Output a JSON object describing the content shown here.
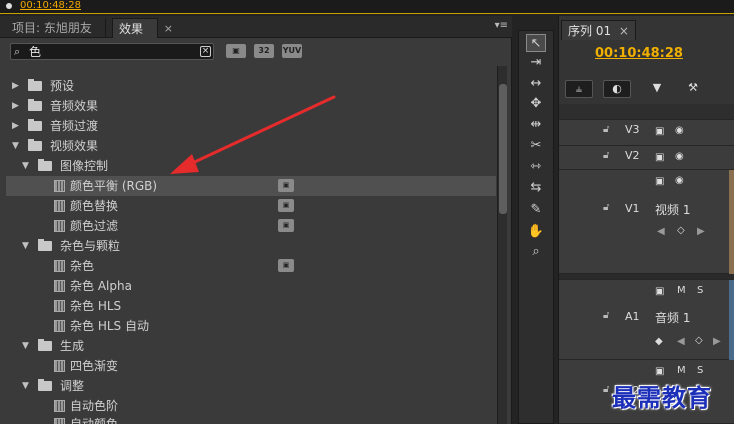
{
  "top_timecode": "00:10:48:28",
  "tabs": {
    "project": "项目: 东旭朋友",
    "effects": "效果",
    "close": "×",
    "menu": "▾≡"
  },
  "search": {
    "value": "色",
    "clear": "×"
  },
  "filter_buttons": [
    "32",
    "YUV"
  ],
  "tree": [
    {
      "label": "预设"
    },
    {
      "label": "音频效果"
    },
    {
      "label": "音频过渡"
    },
    {
      "label": "视频效果"
    },
    {
      "label": "图像控制"
    },
    {
      "label": "颜色平衡 (RGB)"
    },
    {
      "label": "颜色替换"
    },
    {
      "label": "颜色过滤"
    },
    {
      "label": "杂色与颗粒"
    },
    {
      "label": "杂色"
    },
    {
      "label": "杂色 Alpha"
    },
    {
      "label": "杂色 HLS"
    },
    {
      "label": "杂色 HLS 自动"
    },
    {
      "label": "生成"
    },
    {
      "label": "四色渐变"
    },
    {
      "label": "调整"
    },
    {
      "label": "自动色阶"
    },
    {
      "label": "自动颜色"
    }
  ],
  "sequence": {
    "tab": "序列 01",
    "close": "×",
    "timecode": "00:10:48:28",
    "tracks": {
      "v3": "V3",
      "v2": "V2",
      "v1": "V1",
      "v1_name": "视频 1",
      "a1": "A1",
      "a1_name": "音频 1",
      "a2": "A2",
      "m": "M",
      "s": "S"
    }
  },
  "watermark": "最需教育"
}
